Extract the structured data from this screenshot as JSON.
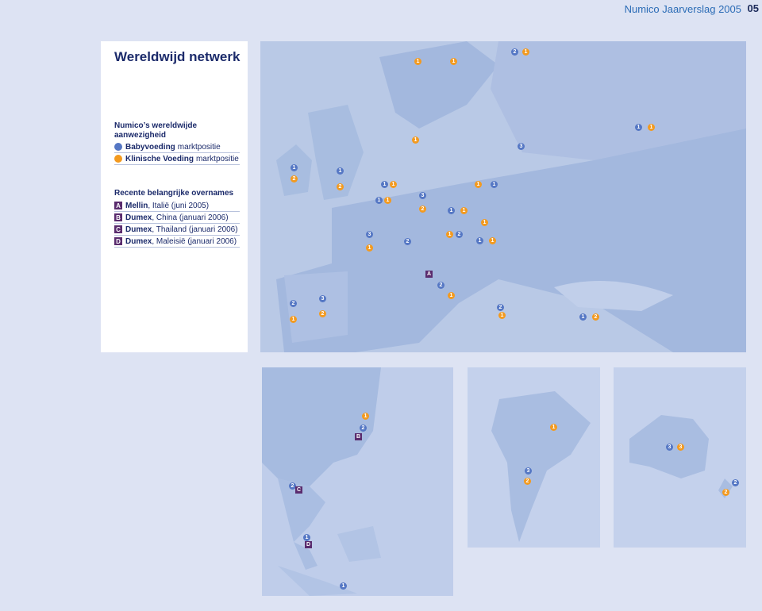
{
  "header": {
    "title": "Numico Jaarverslag 2005",
    "page": "05"
  },
  "panel": {
    "title": "Wereldwijd netwerk",
    "subtitle": "Numico’s wereldwijde aanwezigheid",
    "legend": [
      {
        "bold": "Babyvoeding",
        "text": "marktpositie",
        "color": "#5577c4"
      },
      {
        "bold": "Klinische Voeding",
        "text": "marktpositie",
        "color": "#f39a1f"
      }
    ],
    "acquisitions_title": "Recente belangrijke overnames",
    "acquisitions": [
      {
        "letter": "A",
        "bold": "Mellin",
        "text": ", Italië (juni 2005)"
      },
      {
        "letter": "B",
        "bold": "Dumex",
        "text": ", China (januari 2006)"
      },
      {
        "letter": "C",
        "bold": "Dumex",
        "text": ", Thailand (januari 2006)"
      },
      {
        "letter": "D",
        "bold": "Dumex",
        "text": ", Maleisië (januari 2006)"
      }
    ]
  },
  "colors": {
    "baby": "#5577c4",
    "clinical": "#f39a1f",
    "letter": "#5a2c6e",
    "text": "#1b2a6a"
  },
  "maps": {
    "europe": {
      "markers": [
        {
          "v": "1",
          "c": "orange"
        },
        {
          "v": "1",
          "c": "orange"
        },
        {
          "v": "2",
          "c": "blue"
        },
        {
          "v": "1",
          "c": "orange"
        },
        {
          "v": "1",
          "c": "blue"
        },
        {
          "v": "1",
          "c": "orange"
        },
        {
          "v": "1",
          "c": "orange"
        },
        {
          "v": "3",
          "c": "blue"
        },
        {
          "v": "1",
          "c": "blue"
        },
        {
          "v": "2",
          "c": "orange"
        },
        {
          "v": "1",
          "c": "blue"
        },
        {
          "v": "2",
          "c": "orange"
        },
        {
          "v": "1",
          "c": "blue"
        },
        {
          "v": "1",
          "c": "orange"
        },
        {
          "v": "1",
          "c": "orange"
        },
        {
          "v": "1",
          "c": "blue"
        },
        {
          "v": "3",
          "c": "blue"
        },
        {
          "v": "1",
          "c": "blue"
        },
        {
          "v": "1",
          "c": "orange"
        },
        {
          "v": "2",
          "c": "orange"
        },
        {
          "v": "1",
          "c": "blue"
        },
        {
          "v": "1",
          "c": "orange"
        },
        {
          "v": "1",
          "c": "orange"
        },
        {
          "v": "3",
          "c": "blue"
        },
        {
          "v": "1",
          "c": "orange"
        },
        {
          "v": "2",
          "c": "blue"
        },
        {
          "v": "1",
          "c": "orange"
        },
        {
          "v": "2",
          "c": "blue"
        },
        {
          "v": "1",
          "c": "blue"
        },
        {
          "v": "1",
          "c": "orange"
        },
        {
          "v": "2",
          "c": "blue"
        },
        {
          "v": "1",
          "c": "orange"
        },
        {
          "v": "2",
          "c": "blue"
        },
        {
          "v": "1",
          "c": "orange"
        },
        {
          "v": "3",
          "c": "blue"
        },
        {
          "v": "2",
          "c": "orange"
        },
        {
          "v": "2",
          "c": "blue"
        },
        {
          "v": "1",
          "c": "orange"
        },
        {
          "v": "1",
          "c": "blue"
        },
        {
          "v": "2",
          "c": "orange"
        }
      ],
      "letters": [
        "A"
      ]
    },
    "asia": {
      "markers": [
        {
          "v": "1",
          "c": "orange"
        },
        {
          "v": "2",
          "c": "blue"
        },
        {
          "v": "2",
          "c": "blue"
        },
        {
          "v": "1",
          "c": "blue"
        },
        {
          "v": "1",
          "c": "blue"
        }
      ],
      "letters": [
        "B",
        "C",
        "D"
      ]
    },
    "south_america": {
      "markers": [
        {
          "v": "1",
          "c": "orange"
        },
        {
          "v": "3",
          "c": "blue"
        },
        {
          "v": "2",
          "c": "orange"
        }
      ]
    },
    "australia": {
      "markers": [
        {
          "v": "3",
          "c": "blue"
        },
        {
          "v": "3",
          "c": "orange"
        },
        {
          "v": "2",
          "c": "blue"
        },
        {
          "v": "2",
          "c": "orange"
        }
      ]
    }
  }
}
